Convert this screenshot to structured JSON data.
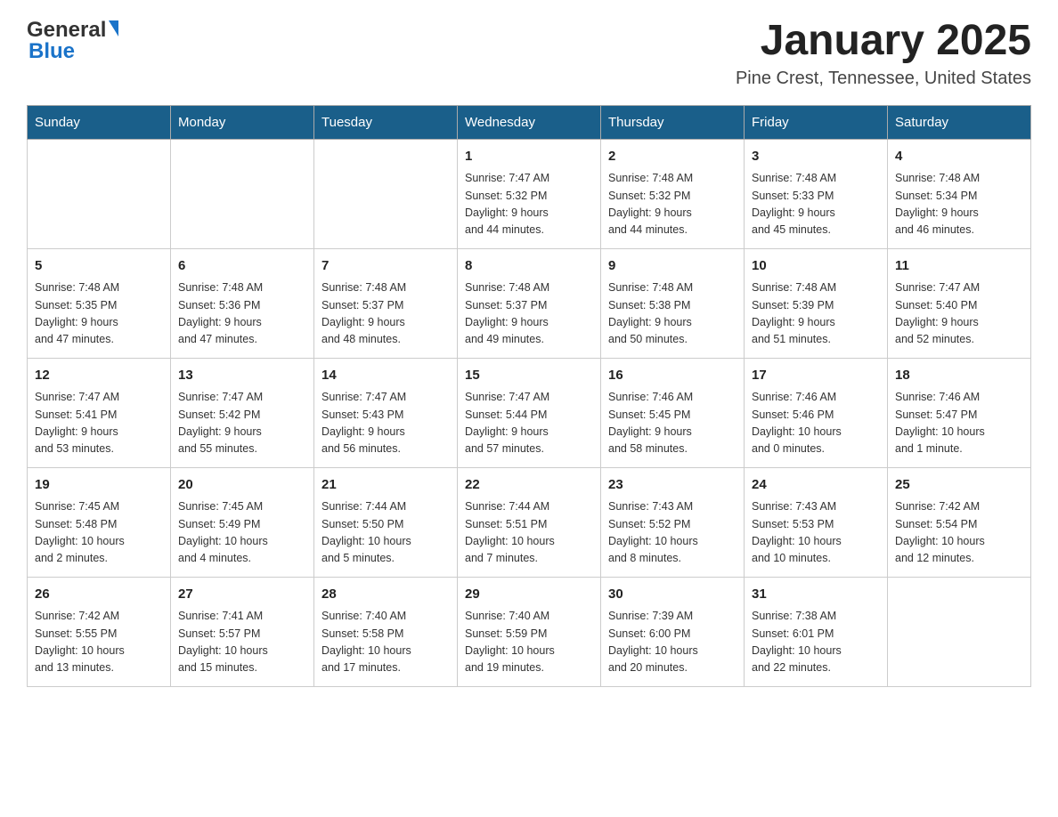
{
  "header": {
    "logo_general": "General",
    "logo_blue": "Blue",
    "month": "January 2025",
    "location": "Pine Crest, Tennessee, United States"
  },
  "days_of_week": [
    "Sunday",
    "Monday",
    "Tuesday",
    "Wednesday",
    "Thursday",
    "Friday",
    "Saturday"
  ],
  "weeks": [
    [
      {
        "day": "",
        "info": ""
      },
      {
        "day": "",
        "info": ""
      },
      {
        "day": "",
        "info": ""
      },
      {
        "day": "1",
        "info": "Sunrise: 7:47 AM\nSunset: 5:32 PM\nDaylight: 9 hours\nand 44 minutes."
      },
      {
        "day": "2",
        "info": "Sunrise: 7:48 AM\nSunset: 5:32 PM\nDaylight: 9 hours\nand 44 minutes."
      },
      {
        "day": "3",
        "info": "Sunrise: 7:48 AM\nSunset: 5:33 PM\nDaylight: 9 hours\nand 45 minutes."
      },
      {
        "day": "4",
        "info": "Sunrise: 7:48 AM\nSunset: 5:34 PM\nDaylight: 9 hours\nand 46 minutes."
      }
    ],
    [
      {
        "day": "5",
        "info": "Sunrise: 7:48 AM\nSunset: 5:35 PM\nDaylight: 9 hours\nand 47 minutes."
      },
      {
        "day": "6",
        "info": "Sunrise: 7:48 AM\nSunset: 5:36 PM\nDaylight: 9 hours\nand 47 minutes."
      },
      {
        "day": "7",
        "info": "Sunrise: 7:48 AM\nSunset: 5:37 PM\nDaylight: 9 hours\nand 48 minutes."
      },
      {
        "day": "8",
        "info": "Sunrise: 7:48 AM\nSunset: 5:37 PM\nDaylight: 9 hours\nand 49 minutes."
      },
      {
        "day": "9",
        "info": "Sunrise: 7:48 AM\nSunset: 5:38 PM\nDaylight: 9 hours\nand 50 minutes."
      },
      {
        "day": "10",
        "info": "Sunrise: 7:48 AM\nSunset: 5:39 PM\nDaylight: 9 hours\nand 51 minutes."
      },
      {
        "day": "11",
        "info": "Sunrise: 7:47 AM\nSunset: 5:40 PM\nDaylight: 9 hours\nand 52 minutes."
      }
    ],
    [
      {
        "day": "12",
        "info": "Sunrise: 7:47 AM\nSunset: 5:41 PM\nDaylight: 9 hours\nand 53 minutes."
      },
      {
        "day": "13",
        "info": "Sunrise: 7:47 AM\nSunset: 5:42 PM\nDaylight: 9 hours\nand 55 minutes."
      },
      {
        "day": "14",
        "info": "Sunrise: 7:47 AM\nSunset: 5:43 PM\nDaylight: 9 hours\nand 56 minutes."
      },
      {
        "day": "15",
        "info": "Sunrise: 7:47 AM\nSunset: 5:44 PM\nDaylight: 9 hours\nand 57 minutes."
      },
      {
        "day": "16",
        "info": "Sunrise: 7:46 AM\nSunset: 5:45 PM\nDaylight: 9 hours\nand 58 minutes."
      },
      {
        "day": "17",
        "info": "Sunrise: 7:46 AM\nSunset: 5:46 PM\nDaylight: 10 hours\nand 0 minutes."
      },
      {
        "day": "18",
        "info": "Sunrise: 7:46 AM\nSunset: 5:47 PM\nDaylight: 10 hours\nand 1 minute."
      }
    ],
    [
      {
        "day": "19",
        "info": "Sunrise: 7:45 AM\nSunset: 5:48 PM\nDaylight: 10 hours\nand 2 minutes."
      },
      {
        "day": "20",
        "info": "Sunrise: 7:45 AM\nSunset: 5:49 PM\nDaylight: 10 hours\nand 4 minutes."
      },
      {
        "day": "21",
        "info": "Sunrise: 7:44 AM\nSunset: 5:50 PM\nDaylight: 10 hours\nand 5 minutes."
      },
      {
        "day": "22",
        "info": "Sunrise: 7:44 AM\nSunset: 5:51 PM\nDaylight: 10 hours\nand 7 minutes."
      },
      {
        "day": "23",
        "info": "Sunrise: 7:43 AM\nSunset: 5:52 PM\nDaylight: 10 hours\nand 8 minutes."
      },
      {
        "day": "24",
        "info": "Sunrise: 7:43 AM\nSunset: 5:53 PM\nDaylight: 10 hours\nand 10 minutes."
      },
      {
        "day": "25",
        "info": "Sunrise: 7:42 AM\nSunset: 5:54 PM\nDaylight: 10 hours\nand 12 minutes."
      }
    ],
    [
      {
        "day": "26",
        "info": "Sunrise: 7:42 AM\nSunset: 5:55 PM\nDaylight: 10 hours\nand 13 minutes."
      },
      {
        "day": "27",
        "info": "Sunrise: 7:41 AM\nSunset: 5:57 PM\nDaylight: 10 hours\nand 15 minutes."
      },
      {
        "day": "28",
        "info": "Sunrise: 7:40 AM\nSunset: 5:58 PM\nDaylight: 10 hours\nand 17 minutes."
      },
      {
        "day": "29",
        "info": "Sunrise: 7:40 AM\nSunset: 5:59 PM\nDaylight: 10 hours\nand 19 minutes."
      },
      {
        "day": "30",
        "info": "Sunrise: 7:39 AM\nSunset: 6:00 PM\nDaylight: 10 hours\nand 20 minutes."
      },
      {
        "day": "31",
        "info": "Sunrise: 7:38 AM\nSunset: 6:01 PM\nDaylight: 10 hours\nand 22 minutes."
      },
      {
        "day": "",
        "info": ""
      }
    ]
  ]
}
